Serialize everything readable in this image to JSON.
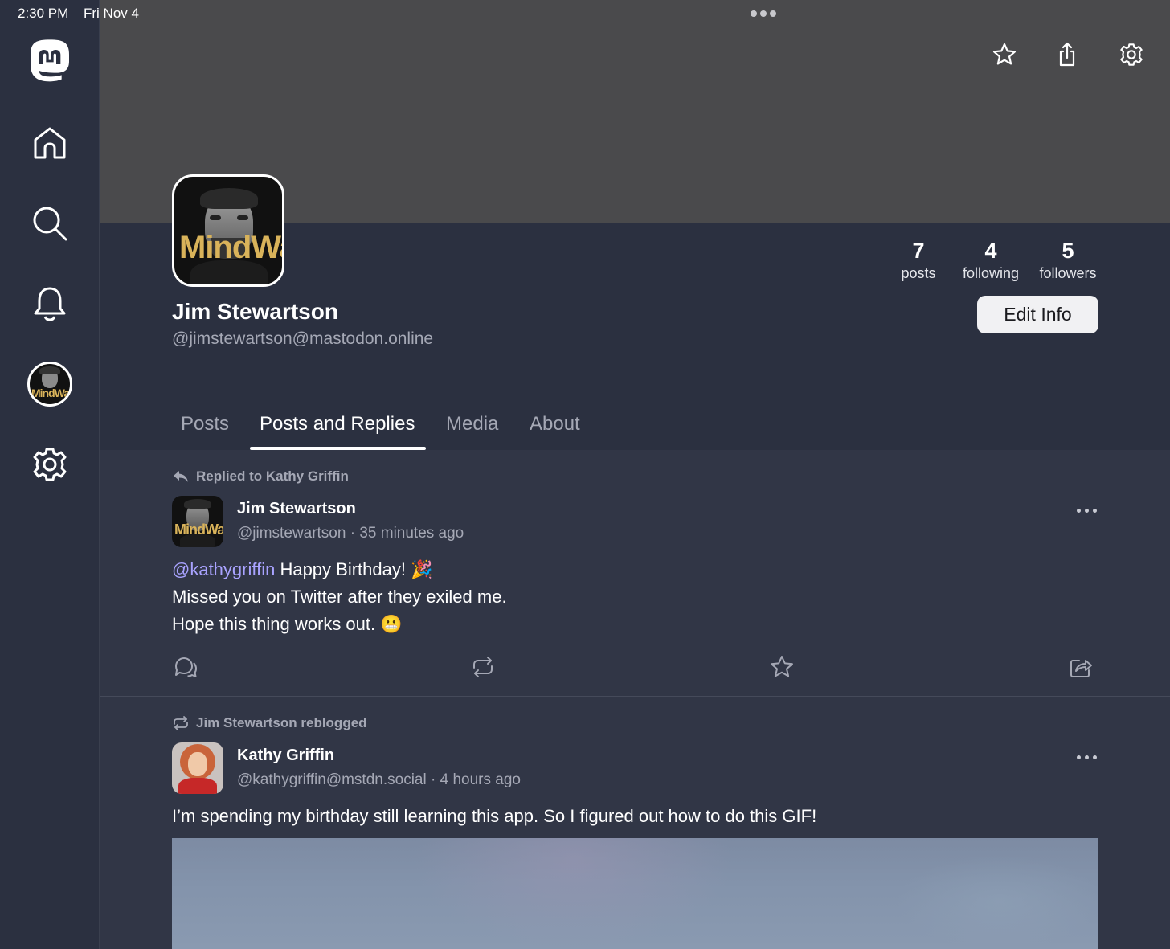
{
  "status_bar": {
    "time": "2:30 PM",
    "date": "Fri Nov 4"
  },
  "profile": {
    "name": "Jim Stewartson",
    "handle": "@jimstewartson@mastodon.online",
    "avatar_text": "MindWar",
    "stats": [
      {
        "value": "7",
        "label": "posts"
      },
      {
        "value": "4",
        "label": "following"
      },
      {
        "value": "5",
        "label": "followers"
      }
    ],
    "edit_label": "Edit Info"
  },
  "tabs": [
    {
      "label": "Posts"
    },
    {
      "label": "Posts and Replies"
    },
    {
      "label": "Media"
    },
    {
      "label": "About"
    }
  ],
  "active_tab": "Posts and Replies",
  "posts": [
    {
      "context": "Replied to Kathy Griffin",
      "author": "Jim Stewartson",
      "handle": "@jimstewartson",
      "time": "35 minutes ago",
      "mention": "@kathygriffin",
      "line1_rest": " Happy Birthday! 🎉",
      "line2": "Missed you on Twitter after they exiled me.",
      "line3": "Hope this thing works out. 😬"
    },
    {
      "context": "Jim Stewartson reblogged",
      "author": "Kathy Griffin",
      "handle": "@kathygriffin@mstdn.social",
      "time": "4 hours ago",
      "body": "I’m spending my birthday still learning this app. So I figured out how to do this GIF!"
    }
  ],
  "colors": {
    "sidebar": "#2b3040",
    "banner": "#4a4a4c",
    "feed": "#313646",
    "mention": "#a9a3ff",
    "muted_text": "#a5a8b5"
  },
  "icons": {
    "sidebar": [
      "mastodon-logo-icon",
      "home-icon",
      "search-icon",
      "bell-icon",
      "profile-avatar",
      "gear-icon"
    ],
    "top_actions": [
      "star-icon",
      "share-icon",
      "gear-icon"
    ],
    "post_actions": [
      "reply-icon",
      "boost-icon",
      "favorite-icon",
      "share-icon"
    ]
  }
}
